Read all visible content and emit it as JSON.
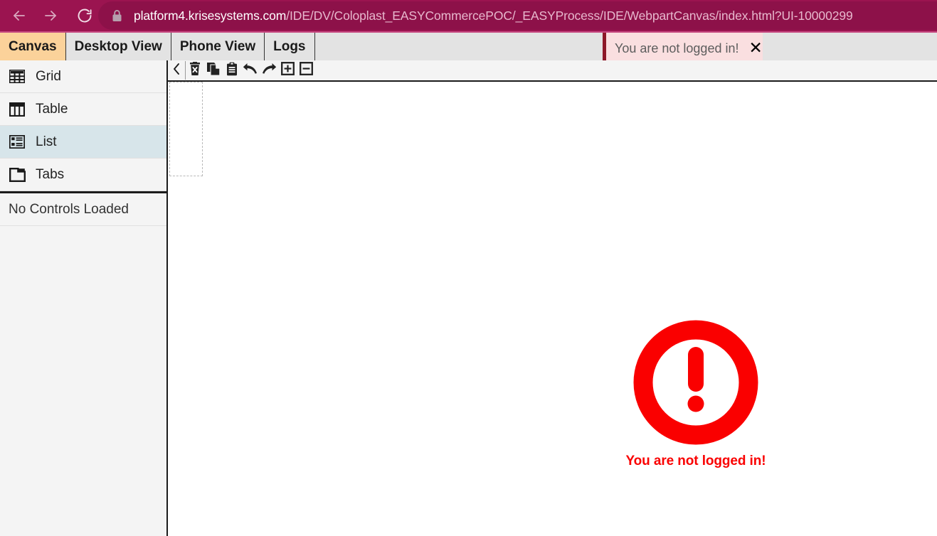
{
  "browser": {
    "back_icon": "arrow-left-icon",
    "forward_icon": "arrow-right-icon",
    "reload_icon": "reload-icon",
    "lock_icon": "lock-icon",
    "url_host": "platform4.krisesystems.com",
    "url_path": "/IDE/DV/Coloplast_EASYCommercePOC/_EASYProcess/IDE/WebpartCanvas/index.html?UI-10000299",
    "chrome_color": "#9b1450",
    "url_pill_color": "#8d1149"
  },
  "tabs": [
    {
      "label": "Canvas",
      "active": true
    },
    {
      "label": "Desktop View",
      "active": false
    },
    {
      "label": "Phone View",
      "active": false
    },
    {
      "label": "Logs",
      "active": false
    }
  ],
  "notification": {
    "text": "You are not logged in!",
    "close_label": "✕",
    "accent_color": "#8d1828",
    "background_color": "#fadfe0"
  },
  "sidebar": {
    "items": [
      {
        "label": "Grid",
        "icon": "grid-icon",
        "selected": false
      },
      {
        "label": "Table",
        "icon": "table-icon",
        "selected": false
      },
      {
        "label": "List",
        "icon": "list-icon",
        "selected": true
      },
      {
        "label": "Tabs",
        "icon": "tabs-icon",
        "selected": false
      }
    ],
    "status": "No Controls Loaded",
    "selected_color": "#d7e5ea"
  },
  "toolbar": {
    "buttons": [
      {
        "name": "collapse-panel-button",
        "icon": "chevron-left-icon"
      },
      {
        "name": "delete-button",
        "icon": "trash-delete-icon"
      },
      {
        "name": "copy-button",
        "icon": "copy-icon"
      },
      {
        "name": "paste-button",
        "icon": "paste-clipboard-icon"
      },
      {
        "name": "undo-button",
        "icon": "undo-icon"
      },
      {
        "name": "redo-button",
        "icon": "redo-icon"
      },
      {
        "name": "expand-all-button",
        "icon": "plus-box-icon"
      },
      {
        "name": "collapse-all-button",
        "icon": "minus-box-icon"
      }
    ]
  },
  "canvas": {
    "dropzone_name": "empty-dropzone"
  },
  "error": {
    "icon": "exclamation-circle-icon",
    "message": "You are not logged in!",
    "color": "#fa0000"
  }
}
